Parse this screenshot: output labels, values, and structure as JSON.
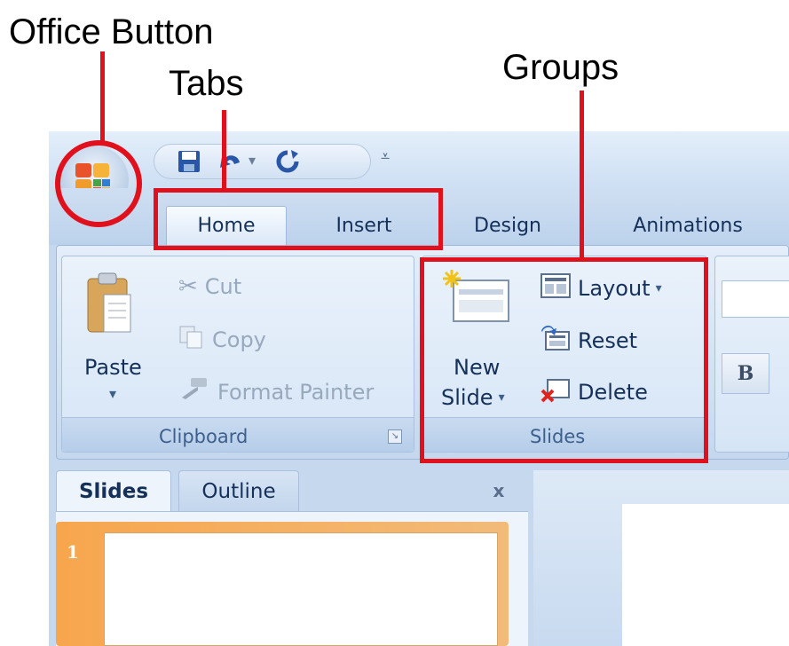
{
  "annotations": {
    "office_button": "Office Button",
    "tabs": "Tabs",
    "groups": "Groups"
  },
  "ribbon_tabs": [
    "Home",
    "Insert",
    "Design",
    "Animations"
  ],
  "clipboard_group": {
    "paste_label": "Paste",
    "cut_label": "Cut",
    "copy_label": "Copy",
    "format_painter_label": "Format Painter",
    "group_label": "Clipboard"
  },
  "slides_group": {
    "new_slide_line1": "New",
    "new_slide_line2": "Slide",
    "layout_label": "Layout",
    "reset_label": "Reset",
    "delete_label": "Delete",
    "group_label": "Slides"
  },
  "font_group": {
    "bold_label": "B"
  },
  "pane_tabs": {
    "slides": "Slides",
    "outline": "Outline",
    "close": "x"
  },
  "slide_thumbnail": {
    "number": "1"
  },
  "colors": {
    "annotation_red": "#e0101c",
    "ribbon_text": "#15315a",
    "thumbnail_accent": "#f7a64d"
  }
}
